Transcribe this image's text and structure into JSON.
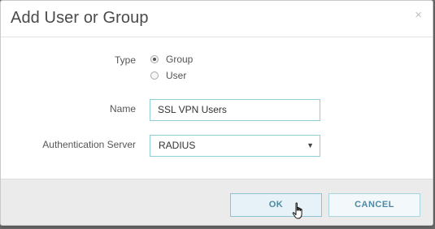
{
  "dialog": {
    "title": "Add User or Group",
    "close_glyph": "×"
  },
  "form": {
    "type_label": "Type",
    "type_options": [
      {
        "label": "Group",
        "selected": true
      },
      {
        "label": "User",
        "selected": false
      }
    ],
    "name_label": "Name",
    "name_value": "SSL VPN Users",
    "auth_label": "Authentication Server",
    "auth_value": "RADIUS",
    "auth_arrow": "▼"
  },
  "footer": {
    "ok_label": "OK",
    "cancel_label": "CANCEL"
  },
  "icons": {
    "cursor": "hand-pointer-icon"
  }
}
